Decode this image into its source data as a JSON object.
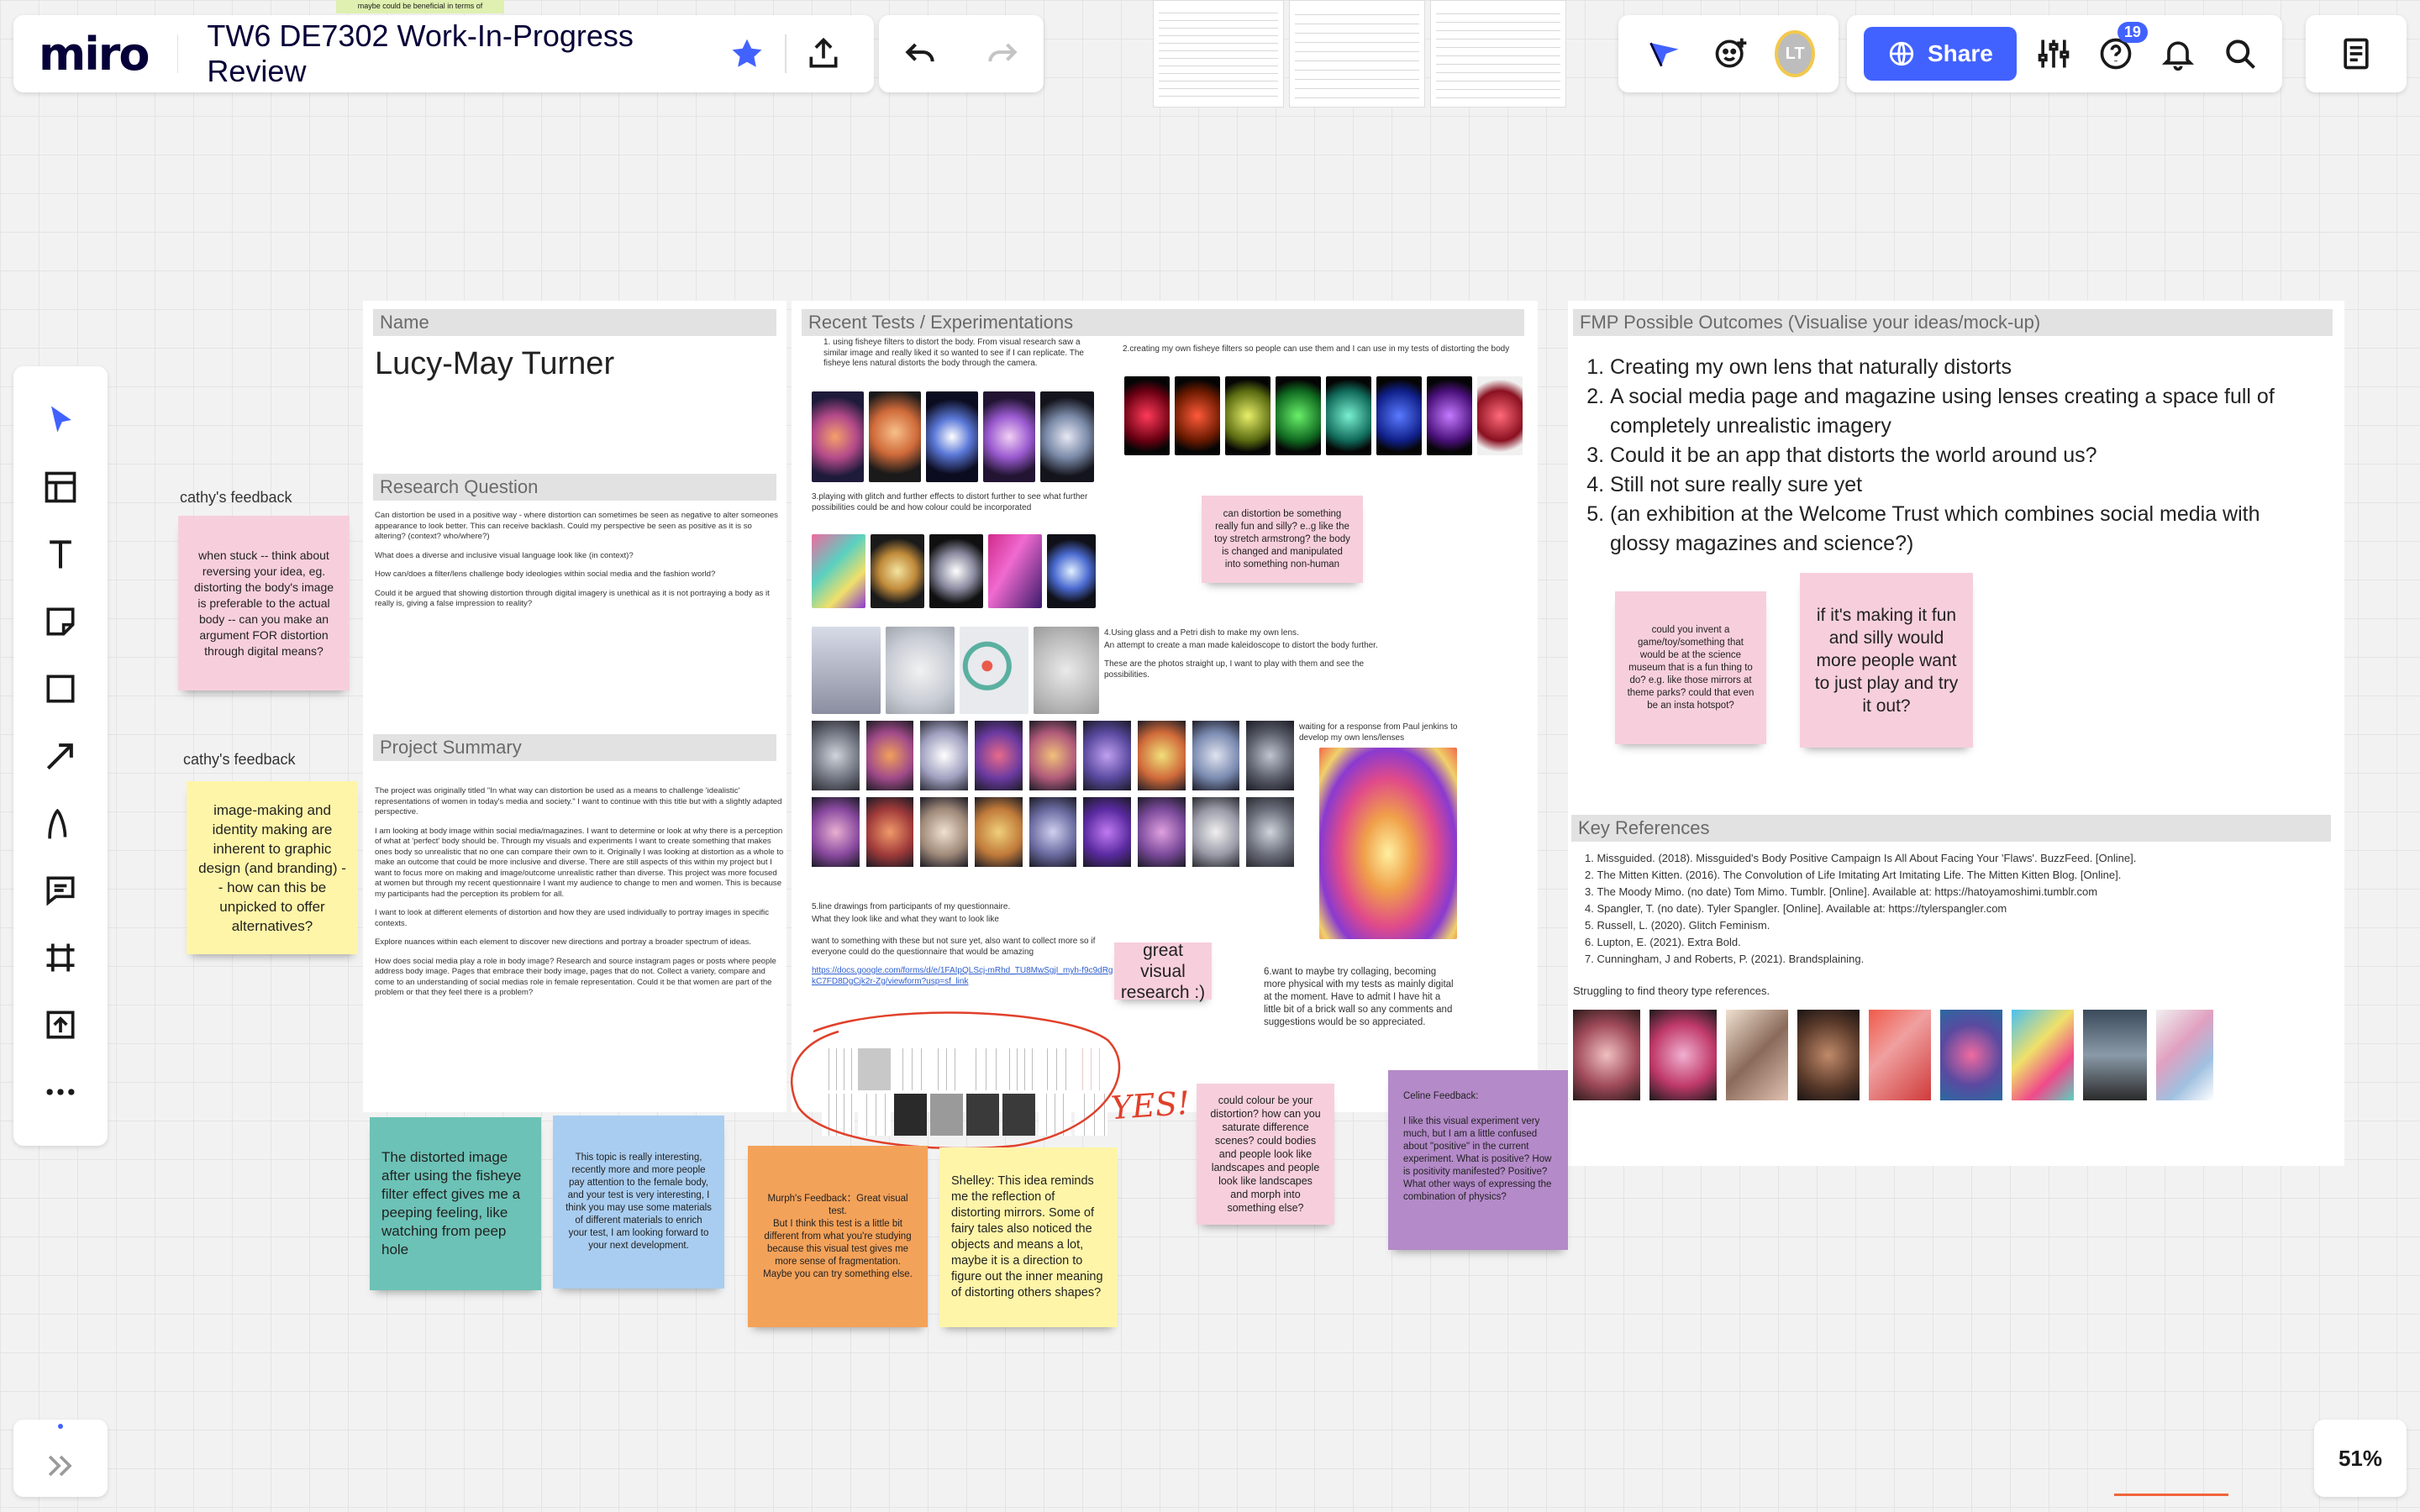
{
  "app": {
    "logo": "miro",
    "board_title": "TW6 DE7302 Work-In-Progress Review",
    "zoom": "51%"
  },
  "toolbar": {
    "share_label": "Share",
    "avatar_initials": "LT",
    "help_badge": "19"
  },
  "top_snippet": "maybe could be beneficial in terms of",
  "name_frame": {
    "header": "Name",
    "name": "Lucy-May Turner"
  },
  "research": {
    "header": "Research Question",
    "paragraphs": [
      "Can distortion be used in a positive way - where distortion can sometimes be seen as negative to alter someones appearance to look better. This can receive backlash. Could my perspective be seen as positive as it is so altering? (context? who/where?)",
      "What does a diverse and inclusive visual language look like (in context)?",
      "How can/does a filter/lens challenge body ideologies within social media and the fashion world?",
      "Could it be argued that showing distortion through digital imagery is unethical as it is not portraying a body as it really is, giving a false impression to reality?"
    ]
  },
  "summary": {
    "header": "Project Summary",
    "paragraphs": [
      "The project was originally titled \"In what way can distortion be used as a means to challenge 'idealistic' representations of women in today's media and society.\" I want to continue with this title but with a slightly adapted perspective.",
      "I am looking at body image within social media/magazines. I want to determine or look at why there is a perception of what at 'perfect' body should be. Through my visuals and experiments I want to create something that makes ones body so unrealistic that no one can compare their own to it. Originally I was looking at distortion as a whole to make an outcome that could be more inclusive and diverse. There are still aspects of this within my project but I want to focus more on making and image/outcome unrealistic rather than diverse. This project was more focused at women but through my recent questionnaire I want my audience to change to men and women. This is because my participants had the perception its problem for all.",
      "I want to look at different elements of distortion and how they are used individually to portray images in specific contexts.",
      "Explore nuances within each element to discover new directions and portray a broader spectrum of ideas.",
      "How does social media play a role in body image? Research and source instagram pages or posts where people address body image. Pages that embrace their body image, pages that do not. Collect a variety, compare and come to an understanding of social medias role in female representation. Could it be that women are part of the problem or that they feel there is a problem?"
    ]
  },
  "tests": {
    "header": "Recent Tests / Experimentations",
    "t1": "1. using fisheye filters to distort the body. From visual research saw a similar image and really liked it so wanted to see if I can replicate. The fisheye lens natural distorts the body through the camera.",
    "t2": "2.creating my own fisheye filters so people can use them and I can use in my tests of distorting the body",
    "t3": "3.playing with glitch and further effects to distort further to see what further possibilities could be and how colour could be incorporated",
    "t4a": "4.Using glass and a Petri dish to make my own lens.",
    "t4b": "An attempt to create a man made kaleidoscope to distort the body further.",
    "t4c": "These are the photos straight up, I want to play with them and see the possibilities.",
    "t5a": "5.line drawings from participants of my questionnaire.",
    "t5b": "What they look like and what they want to look like",
    "t5c": "want to something with these but not sure yet, also want to collect more so if everyone could do the questionnaire that would be amazing",
    "t5link": "https://docs.google.com/forms/d/e/1FAIpQLScj-mRhd_TU8MwSgjI_myh-f9c9dRgkC7FD8DgCjk2r-Zg/viewform?usp=sf_link",
    "waiting": "waiting for a response from Paul jenkins to develop my own lens/lenses",
    "t6": "6.want to maybe try collaging, becoming more physical with my tests as mainly digital at the moment. Have to admit I have hit a little bit of a brick wall so any comments and suggestions would be so appreciated.",
    "yes": "YES!"
  },
  "fmp": {
    "header": "FMP Possible Outcomes (Visualise your ideas/mock-up)",
    "items": [
      "Creating my own lens that naturally distorts",
      "A social media page and magazine using lenses creating a space full of completely unrealistic imagery",
      "Could it be an app that distorts the world around us?",
      "Still not sure really sure yet",
      "(an exhibition at the Welcome Trust which combines social media with glossy magazines and science?)"
    ]
  },
  "refs": {
    "header": "Key References",
    "items": [
      "Missguided. (2018). Missguided's Body Positive Campaign Is All About Facing Your 'Flaws'. BuzzFeed. [Online].",
      "The Mitten Kitten. (2016). The Convolution of Life Imitating Art Imitating Life. The Mitten Kitten Blog. [Online].",
      "The Moody Mimo. (no date) Tom Mimo. Tumblr. [Online]. Available at: https://hatoyamoshimi.tumblr.com",
      "Spangler, T. (no date). Tyler Spangler. [Online]. Available at: https://tylerspangler.com",
      "Russell, L. (2020). Glitch Feminism.",
      "Lupton, E. (2021). Extra Bold.",
      "Cunningham, J and Roberts, P. (2021). Brandsplaining."
    ],
    "struggle": "Struggling to find theory type references."
  },
  "feedback_labels": {
    "c1": "cathy's feedback",
    "c2": "cathy's feedback"
  },
  "stickies": {
    "cathy1": "when stuck -- think about reversing your idea, eg. distorting the body's image is preferable to the actual body -- can you make an argument FOR distortion through digital means?",
    "cathy2": "image-making and identity making are inherent to graphic design (and branding) -- how can this be unpicked to offer alternatives?",
    "fun": "can distortion be something really fun and silly? e..g like the toy stretch armstrong? the body is changed and manipulated into something non-human",
    "visual": "great visual research :)",
    "colour": "could colour be your distortion? how can you saturate difference scenes? could bodies and people look like landscapes and people look like landscapes and morph into something else?",
    "celine": "Celine Feedback:\n\nI like this visual experiment very much, but I am a little confused about \"positive\" in the current experiment. What is positive? How is positivity manifested? Positive? What other ways of expressing the combination of physics?",
    "invent": "could you invent a game/toy/something that would be at the science museum that is a fun thing to do? e.g. like those mirrors at theme parks? could that even be an insta hotspot?",
    "silly": "if it's making it fun and silly would more people want to just play and try it out?",
    "teal": "The distorted image after using the fisheye filter effect gives me a peeping feeling, like watching from peep hole",
    "blue": "This topic is really interesting, recently more and more people pay attention to the female body, and your test is very interesting, I think you may use some materials of different materials to enrich your test, I am looking forward to your next development.",
    "murph": "Murph's Feedback：Great visual test.\nBut I think this test is a little bit different from what you're studying because this visual test gives me more sense of fragmentation.\nMaybe you can try something else.",
    "shelley": "Shelley: This idea reminds me the reflection of distorting mirrors. Some of fairy tales also noticed the objects and means a lot, maybe it is a direction to figure out the inner meaning of distorting others shapes?"
  },
  "colors": {
    "accent": "#4262ff",
    "logo": "#050038",
    "annot": "#e0402a"
  }
}
